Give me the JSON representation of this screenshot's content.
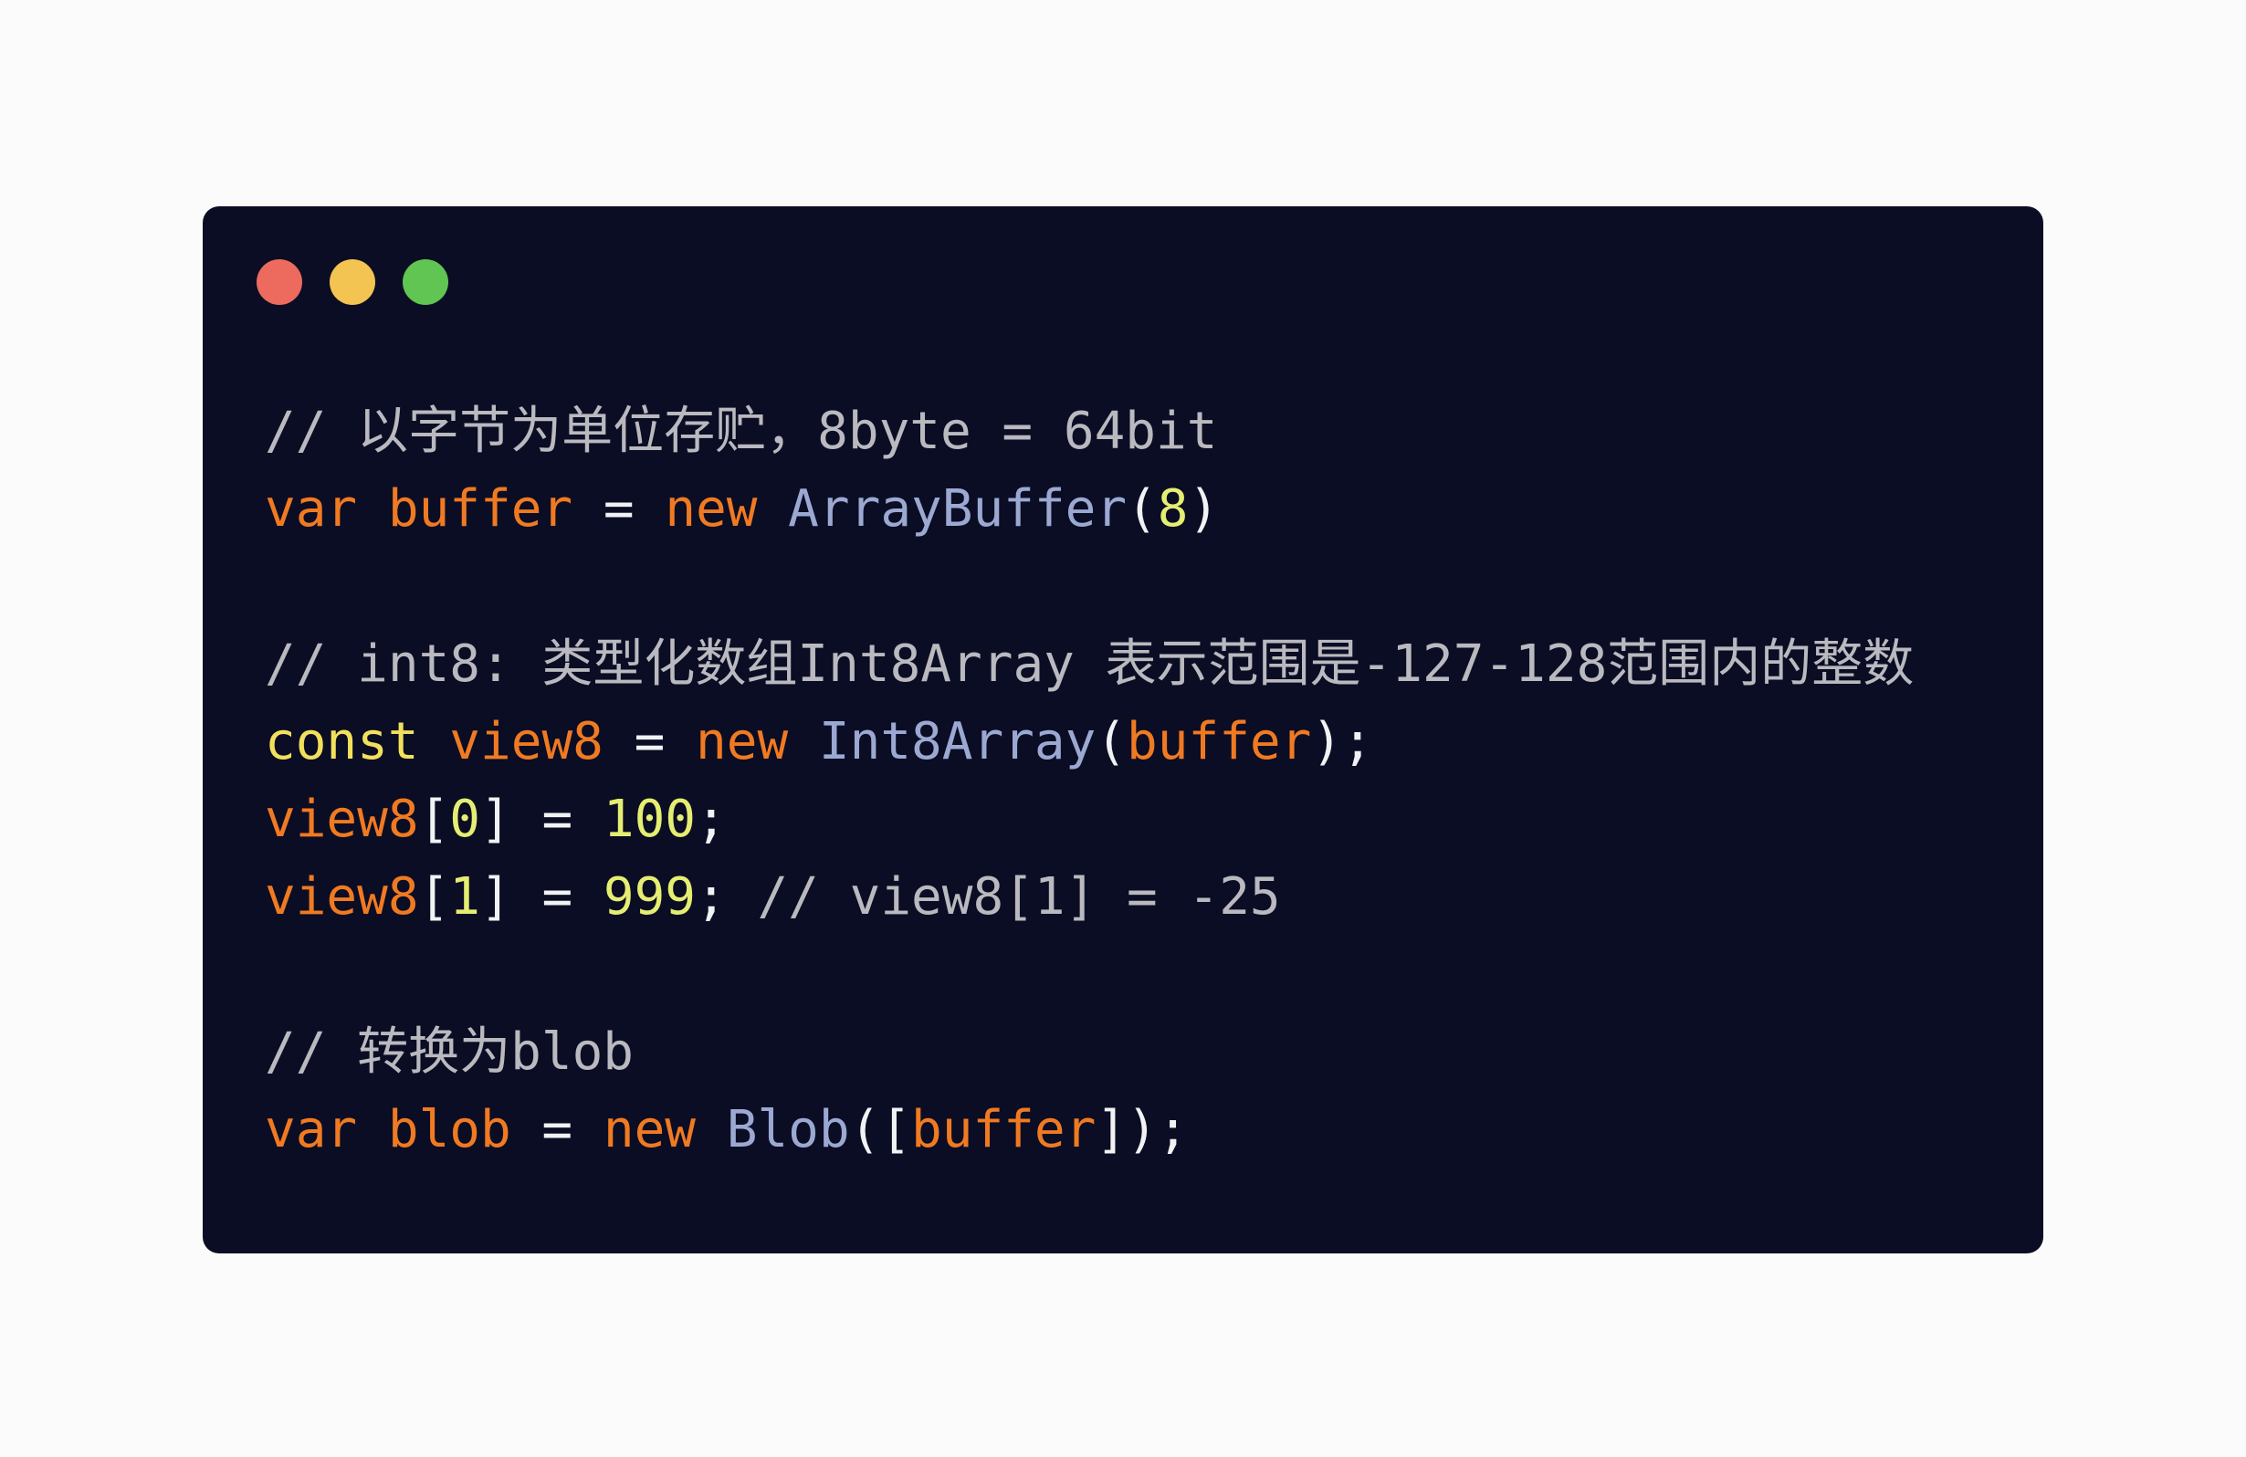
{
  "window": {
    "controls": [
      {
        "name": "close",
        "color": "#ec6b5e"
      },
      {
        "name": "minimize",
        "color": "#f4c452"
      },
      {
        "name": "maximize",
        "color": "#61c554"
      }
    ]
  },
  "code": {
    "lines": [
      [
        {
          "t": "// 以字节为单位存贮，8byte = 64bit",
          "k": "comment"
        }
      ],
      [
        {
          "t": "var ",
          "k": "keyword"
        },
        {
          "t": "buffer",
          "k": "keyword"
        },
        {
          "t": " = ",
          "k": "plain"
        },
        {
          "t": "new ",
          "k": "keyword"
        },
        {
          "t": "ArrayBuffer",
          "k": "class"
        },
        {
          "t": "(",
          "k": "plain"
        },
        {
          "t": "8",
          "k": "number"
        },
        {
          "t": ")",
          "k": "plain"
        }
      ],
      [],
      [
        {
          "t": "// int8: 类型化数组Int8Array 表示范围是-127-128范围内的整数",
          "k": "comment"
        }
      ],
      [
        {
          "t": "const ",
          "k": "const"
        },
        {
          "t": "view8",
          "k": "keyword"
        },
        {
          "t": " = ",
          "k": "plain"
        },
        {
          "t": "new ",
          "k": "keyword"
        },
        {
          "t": "Int8Array",
          "k": "class"
        },
        {
          "t": "(",
          "k": "plain"
        },
        {
          "t": "buffer",
          "k": "keyword"
        },
        {
          "t": ");",
          "k": "plain"
        }
      ],
      [
        {
          "t": "view8",
          "k": "keyword"
        },
        {
          "t": "[",
          "k": "plain"
        },
        {
          "t": "0",
          "k": "number"
        },
        {
          "t": "] = ",
          "k": "plain"
        },
        {
          "t": "100",
          "k": "number"
        },
        {
          "t": ";",
          "k": "plain"
        }
      ],
      [
        {
          "t": "view8",
          "k": "keyword"
        },
        {
          "t": "[",
          "k": "plain"
        },
        {
          "t": "1",
          "k": "number"
        },
        {
          "t": "] = ",
          "k": "plain"
        },
        {
          "t": "999",
          "k": "number"
        },
        {
          "t": "; ",
          "k": "plain"
        },
        {
          "t": "// view8[1] = -25",
          "k": "comment"
        }
      ],
      [],
      [
        {
          "t": "// 转换为blob",
          "k": "comment"
        }
      ],
      [
        {
          "t": "var ",
          "k": "keyword"
        },
        {
          "t": "blob",
          "k": "keyword"
        },
        {
          "t": " = ",
          "k": "plain"
        },
        {
          "t": "new ",
          "k": "keyword"
        },
        {
          "t": "Blob",
          "k": "class"
        },
        {
          "t": "([",
          "k": "plain"
        },
        {
          "t": "buffer",
          "k": "keyword"
        },
        {
          "t": "]);",
          "k": "plain"
        }
      ]
    ]
  }
}
